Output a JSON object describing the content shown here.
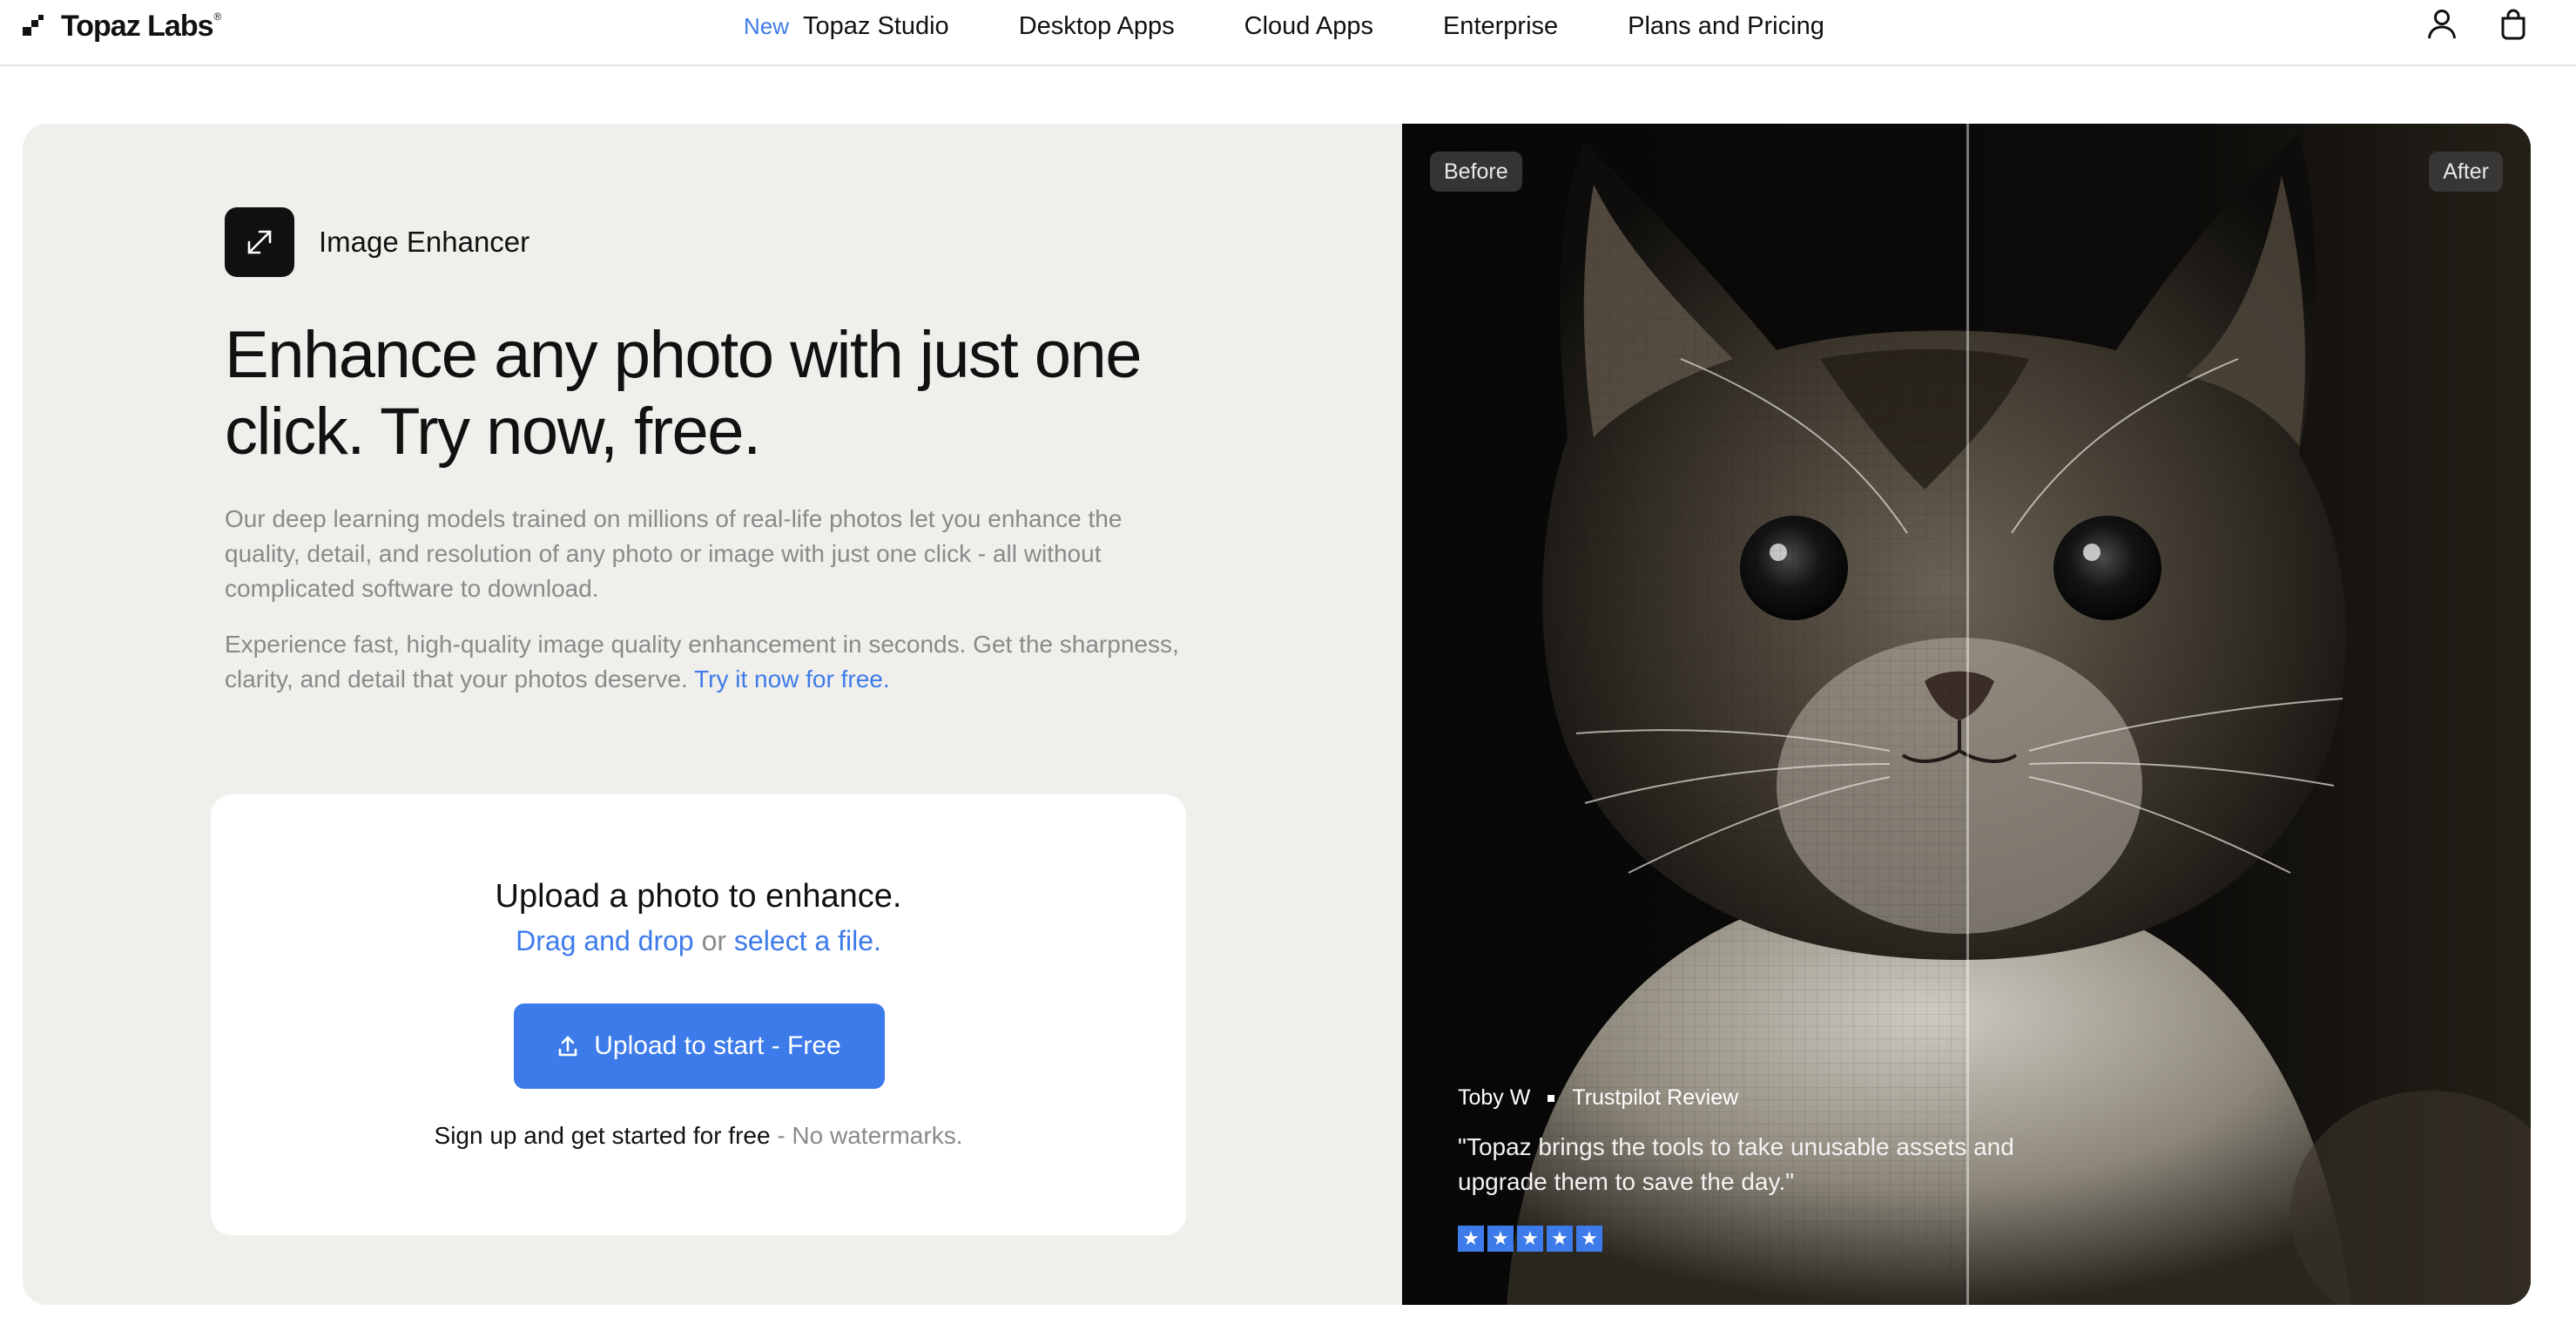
{
  "nav": {
    "logo_text": "Topaz Labs",
    "logo_reg": "®",
    "new_badge": "New",
    "items": [
      "Topaz Studio",
      "Desktop Apps",
      "Cloud Apps",
      "Enterprise",
      "Plans and Pricing"
    ],
    "icons": [
      "account-icon",
      "shopping-bag-icon"
    ]
  },
  "hero": {
    "product_name": "Image Enhancer",
    "product_icon": "expand-arrows-icon",
    "headline": "Enhance any photo with just one click. Try now, free.",
    "paragraph_1": "Our deep learning models trained on millions of real-life photos let you enhance the quality, detail, and resolution of any photo or image with just one click - all without complicated software to download.",
    "paragraph_2": "Experience fast, high-quality image quality enhancement in seconds. Get the sharpness, clarity, and detail that your photos deserve.",
    "paragraph_2_link": "Try it now for free."
  },
  "upload": {
    "title": "Upload a photo to enhance.",
    "drag_link": "Drag and drop",
    "or_text": " or ",
    "select_link": "select a file.",
    "button_label": "Upload to start - Free",
    "button_icon": "upload-icon",
    "note": "Sign up and get started for free",
    "note_muted": " - No watermarks."
  },
  "compare": {
    "before_label": "Before",
    "after_label": "After",
    "review": {
      "author": "Toby W",
      "source": "Trustpilot Review",
      "quote": "\"Topaz brings the tools to take unusable assets and upgrade them to save the day.\"",
      "rating": 5
    }
  },
  "colors": {
    "accent": "#3d7bea",
    "hero_bg": "#f0efeb",
    "text": "#111111",
    "muted": "#8a8a8a"
  }
}
